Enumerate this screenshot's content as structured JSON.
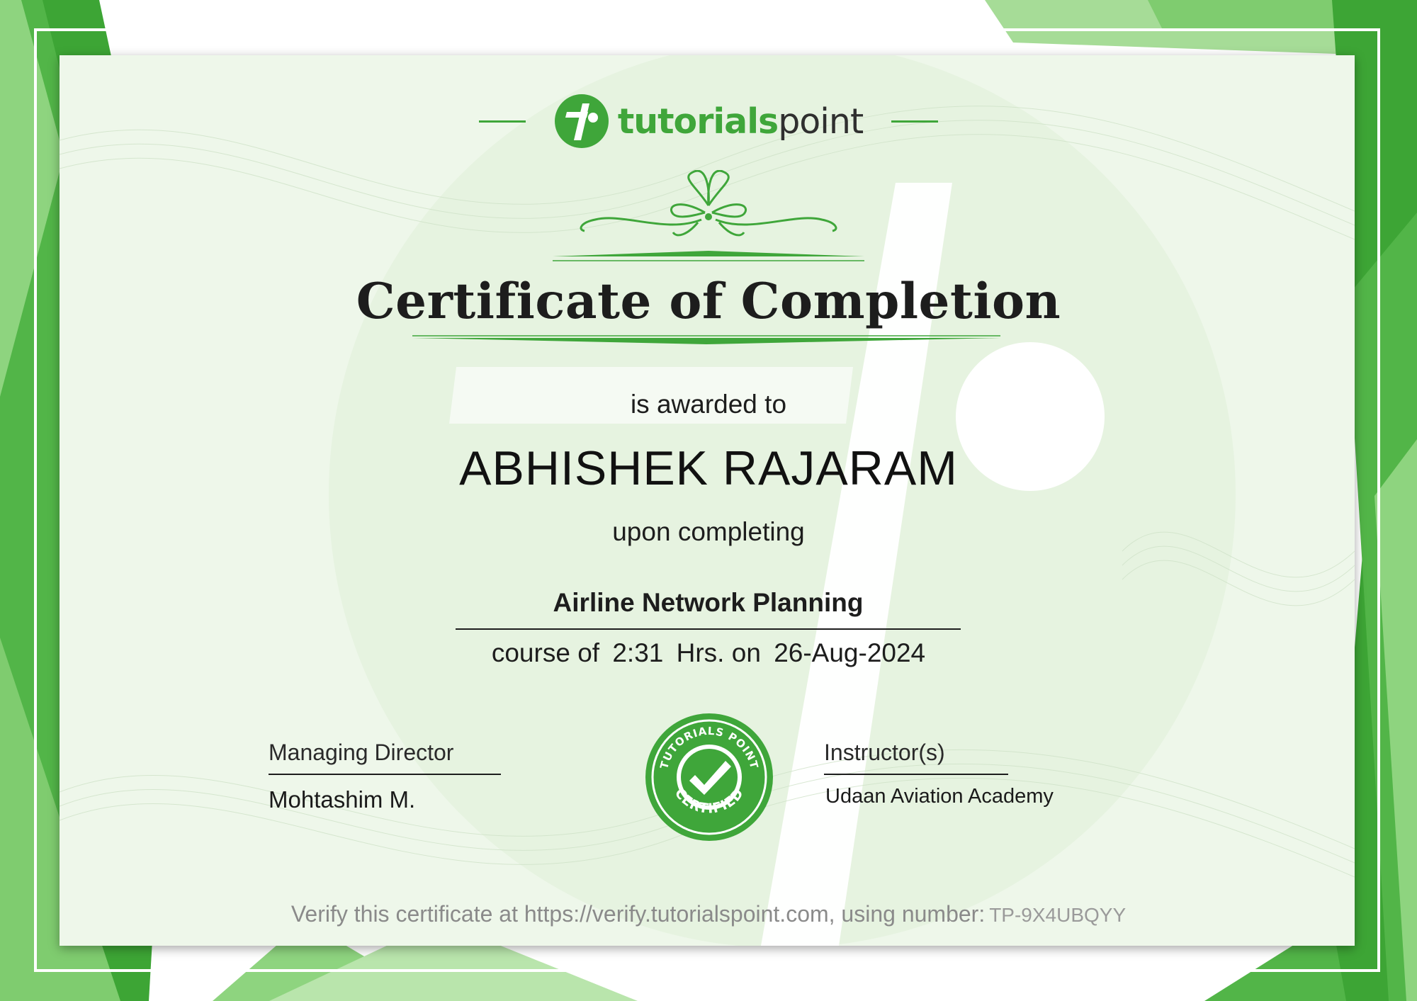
{
  "brand": {
    "name_bold": "tutorials",
    "name_regular": "point",
    "accent_color": "#3fa63a",
    "logo_icon": "tutorialspoint-logo-icon"
  },
  "certificate": {
    "title": "Certificate of Completion",
    "awarded_text": "is awarded to",
    "recipient_name": "ABHISHEK RAJARAM",
    "upon_text": "upon completing",
    "course_name": "Airline Network Planning",
    "course_of_text": "course of",
    "duration": "2:31",
    "hrs_on_text": "Hrs. on",
    "date": "26-Aug-2024"
  },
  "signatures": {
    "left": {
      "title": "Managing Director",
      "name": "Mohtashim M."
    },
    "right": {
      "title": "Instructor(s)",
      "name": "Udaan Aviation Academy"
    }
  },
  "seal": {
    "top_text": "TUTORIALS POINT",
    "bottom_text": "CERTIFIED",
    "icon": "checkmark-icon"
  },
  "verification": {
    "text": "Verify this certificate at https://verify.tutorialspoint.com, using number:",
    "number": "TP-9X4UBQYY"
  }
}
